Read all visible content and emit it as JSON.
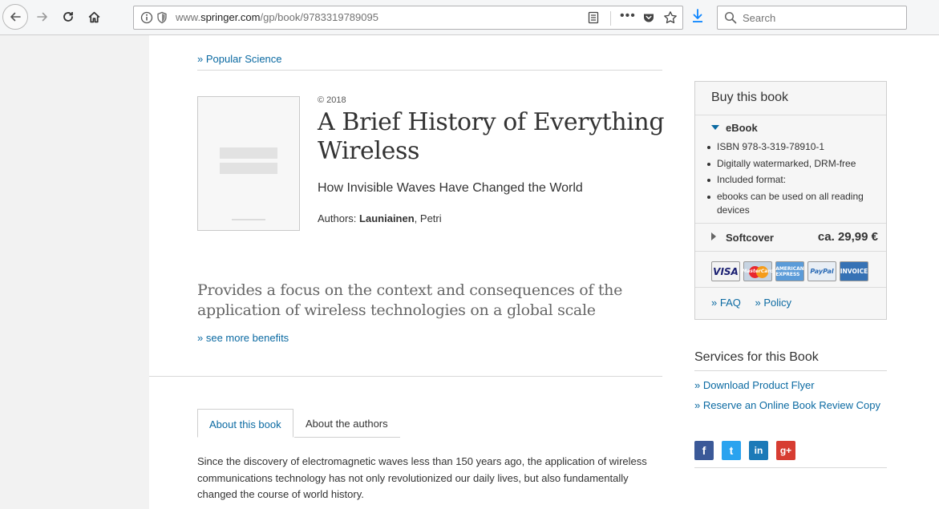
{
  "browser": {
    "url_prefix": "www.",
    "url_host": "springer.com",
    "url_path": "/gp/book/9783319789095",
    "more_glyph": "•••",
    "search_placeholder": "Search"
  },
  "breadcrumb": "» Popular Science",
  "book": {
    "copyright": "© 2018",
    "title": "A Brief History of Everything Wireless",
    "subtitle": "How Invisible Waves Have Changed the World",
    "authors_label": "Authors:",
    "author_last": "Launiainen",
    "author_first": ", Petri"
  },
  "benefit": "Provides a focus on the context and consequences of the application of wireless technologies on a global scale",
  "see_more": "» see more benefits",
  "tabs": [
    {
      "label": "About this book"
    },
    {
      "label": "About the authors"
    }
  ],
  "about_text": "Since the discovery of electromagnetic waves less than 150 years ago, the application of wireless communications technology has not only revolutionized our daily lives, but also fundamentally changed the course of world history.",
  "buy": {
    "header": "Buy this book",
    "ebook_label": "eBook",
    "ebook_items": [
      "ISBN 978-3-319-78910-1",
      "Digitally watermarked, DRM-free",
      "Included format:",
      "ebooks can be used on all reading devices"
    ],
    "softcover_label": "Softcover",
    "softcover_price": "ca. 29,99 €",
    "cards": {
      "visa": "VISA",
      "mastercard": "MasterCard",
      "amex": "AMERICAN EXPRESS",
      "paypal": "PayPal",
      "invoice": "INVOICE"
    },
    "faq": "» FAQ",
    "policy": "» Policy"
  },
  "services": {
    "title": "Services for this Book",
    "links": [
      "» Download Product Flyer",
      "» Reserve an Online Book Review Copy"
    ]
  },
  "social": {
    "facebook": "f",
    "twitter": "t",
    "linkedin": "in",
    "googleplus": "g+"
  },
  "colors": {
    "link": "#0b6aa2",
    "page_bg": "#ffffff",
    "margin_bg": "#f2f2f2"
  }
}
